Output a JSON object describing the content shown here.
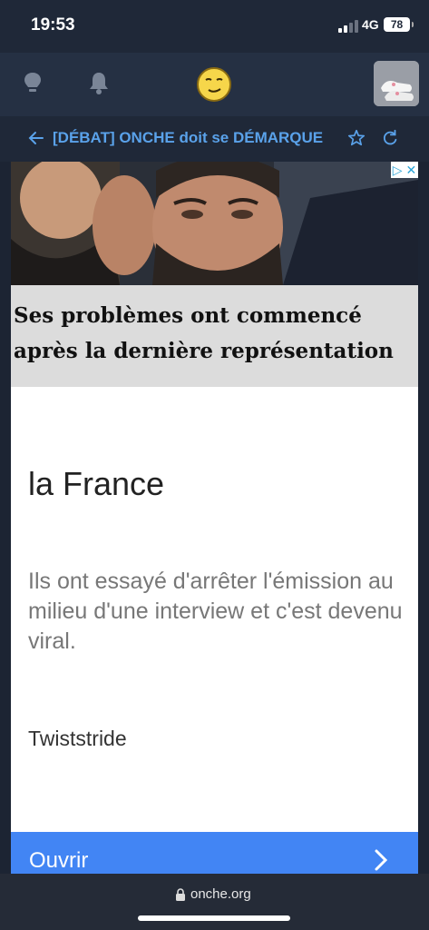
{
  "status": {
    "time": "19:53",
    "network": "4G",
    "battery": "78"
  },
  "nav": {
    "icons": [
      "lightbulb-icon",
      "bell-icon",
      "smiley-icon",
      "avatar"
    ]
  },
  "topic": {
    "back_icon": "arrow-left-icon",
    "title": "[DÉBAT] ONCHE doit se DÉMARQUE",
    "star_icon": "star-icon",
    "refresh_icon": "refresh-icon"
  },
  "ad": {
    "headline": "Ses problèmes ont commencé après la dernière représentation",
    "title": "la France",
    "body": "Ils ont essayé d'arrêter l'émission au milieu d'une interview et c'est devenu viral.",
    "brand": "Twiststride",
    "cta": "Ouvrir",
    "adchoices_icon": "adchoices-icon"
  },
  "browser": {
    "url": "onche.org"
  },
  "colors": {
    "accent": "#5aa2ea",
    "cta": "#4285f4",
    "background": "#1c2433"
  }
}
